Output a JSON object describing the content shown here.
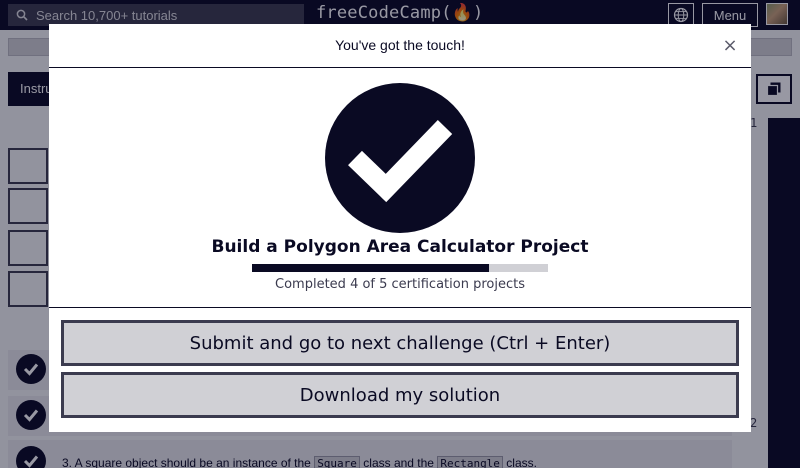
{
  "navbar": {
    "search_placeholder": "Search 10,700+ tutorials",
    "brand": "freeCodeCamp(🔥)",
    "menu_label": "Menu",
    "globe_icon": "globe-icon",
    "avatar": "user-avatar"
  },
  "editor": {
    "instructions_tab": "Instru",
    "line_numbers": [
      "1",
      "2"
    ]
  },
  "tests": {
    "item3_prefix": "3. A square object should be an instance of the ",
    "item3_code1": "Square",
    "item3_middle": " class and the ",
    "item3_code2": "Rectangle",
    "item3_suffix": " class."
  },
  "modal": {
    "title": "You've got the touch!",
    "close_label": "×",
    "project_title": "Build a Polygon Area Calculator Project",
    "progress": {
      "completed": 4,
      "total": 5
    },
    "progress_text": "Completed 4 of 5 certification projects",
    "submit_label": "Submit and go to next challenge (Ctrl + Enter)",
    "download_label": "Download my solution"
  },
  "colors": {
    "navy": "#0a0a23",
    "gray_button": "#d0d0d5",
    "white": "#ffffff"
  }
}
